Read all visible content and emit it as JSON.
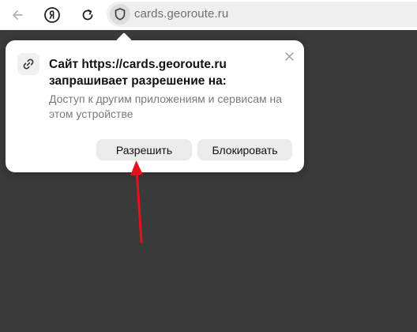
{
  "browser": {
    "url": "cards.georoute.ru",
    "icons": {
      "back": "back-arrow-icon",
      "yandex": "yandex-logo-icon",
      "reload": "reload-icon",
      "security": "shield-icon"
    }
  },
  "permission_popup": {
    "title": "Сайт https://cards.georoute.ru запрашивает разрешение на:",
    "description": "Доступ к другим приложениям и сервисам на этом устройстве",
    "allow_label": "Разрешить",
    "block_label": "Блокировать",
    "icons": {
      "permission": "link-icon",
      "close": "close-icon"
    }
  },
  "annotation": {
    "arrow_color": "#e8111b",
    "points_to": "allow-button"
  },
  "colors": {
    "page_background": "#3a3a3a",
    "popup_background": "#ffffff",
    "button_background": "#ebebeb"
  }
}
